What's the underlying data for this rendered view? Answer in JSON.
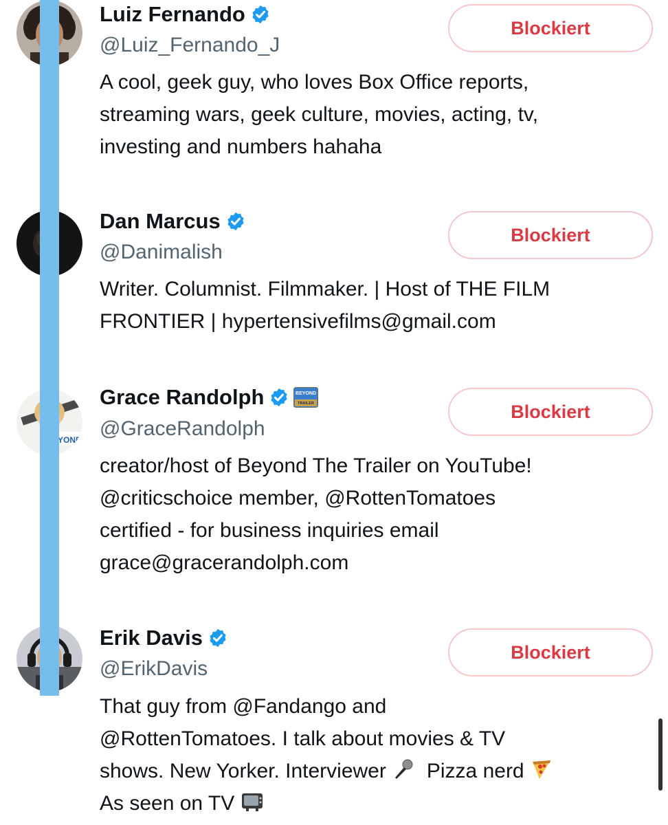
{
  "accounts": [
    {
      "name": "Luiz Fernando",
      "handle": "@Luiz_Fernando_J",
      "bio_lines": [
        "A cool, geek guy, who loves Box Office reports,",
        "streaming wars, geek culture, movies, acting, tv,",
        "investing and numbers hahaha"
      ],
      "button_label": "Blockiert",
      "verified_icon": "verified-badge-icon"
    },
    {
      "name": "Dan Marcus",
      "handle": "@Danimalish",
      "bio_lines": [
        "Writer. Columnist. Filmmaker. | Host of THE FILM",
        "FRONTIER | hypertensivefilms@gmail.com"
      ],
      "button_label": "Blockiert",
      "verified_icon": "verified-badge-icon"
    },
    {
      "name": "Grace Randolph",
      "handle": "@GraceRandolph",
      "bio_lines": [
        "creator/host of Beyond The Trailer on YouTube!",
        "@criticschoice member, @RottenTomatoes",
        "certified - for business inquiries email",
        "grace@gracerandolph.com"
      ],
      "button_label": "Blockiert",
      "verified_icon": "verified-badge-icon",
      "affiliate_icon": "beyond-the-trailer-affiliate-badge",
      "affiliate_text": "BEYOND THE TRAILER"
    },
    {
      "name": "Erik Davis",
      "handle": "@ErikDavis",
      "bio_lines": [
        "That guy from @Fandango and",
        "@RottenTomatoes. I talk about movies & TV",
        "shows. New Yorker. Interviewer",
        "As seen on TV"
      ],
      "bio_line3_tail": "Pizza nerd",
      "bio_emojis": [
        "microphone-icon",
        "pizza-icon",
        "television-icon"
      ],
      "button_label": "Blockiert",
      "verified_icon": "verified-badge-icon"
    }
  ],
  "colors": {
    "verified_blue": "#1d9bf0",
    "blocked_red": "#d93a43",
    "blocked_border": "#f4c7cb",
    "handle_gray": "#536471",
    "thread_line": "#77bdeb"
  }
}
